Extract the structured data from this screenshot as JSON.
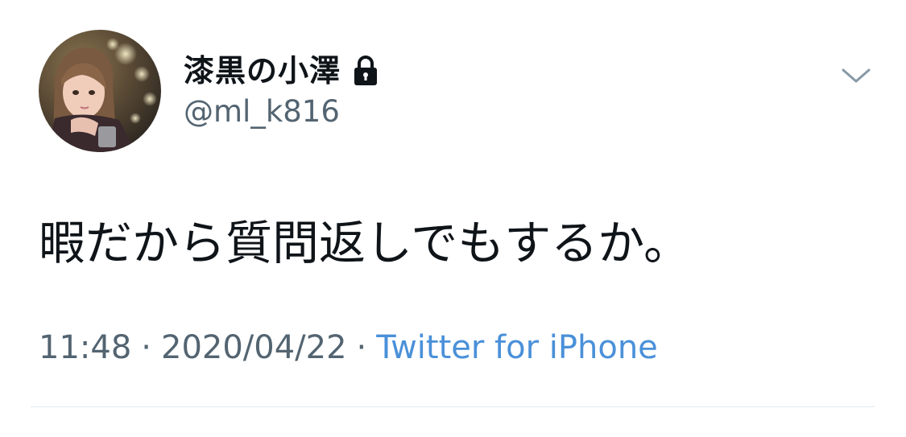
{
  "author": {
    "display_name": "漆黒の小澤",
    "handle": "@ml_k816",
    "protected_icon": "lock-icon",
    "avatar_icon": "profile-photo"
  },
  "tweet": {
    "text": "暇だから質問返しでもするか。"
  },
  "meta": {
    "time": "11:48",
    "separator": "·",
    "date": "2020/04/22",
    "source": "Twitter for iPhone"
  },
  "menu": {
    "icon": "chevron-down-icon"
  },
  "colors": {
    "text_primary": "#0f1419",
    "text_secondary": "#536471",
    "link": "#4a90d9",
    "divider": "#e1e8ed",
    "background": "#ffffff"
  }
}
